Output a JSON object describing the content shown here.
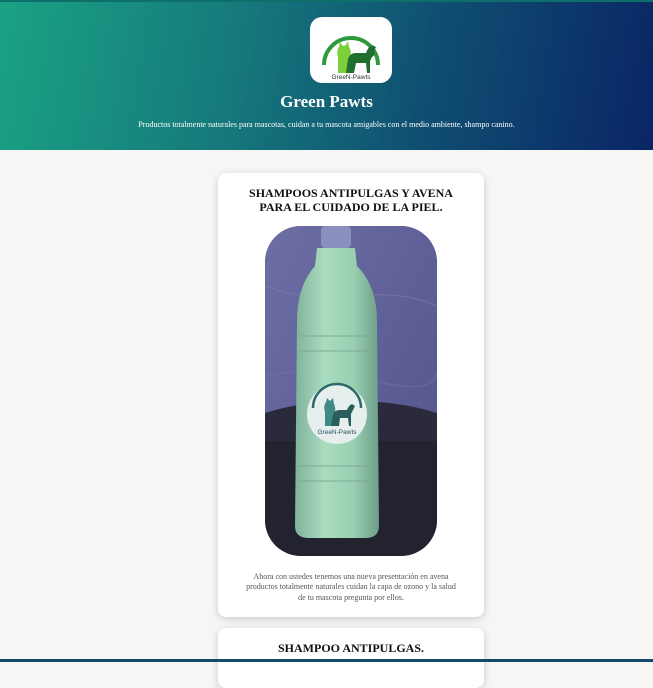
{
  "header": {
    "title": "Green Pawts",
    "tagline": "Productos totalmente naturales para mascotas, cuidan a tu mascota amigables con el medio ambiente, shampo canino.",
    "logo_text": "GreeN-Pawts",
    "logo_icon": "cat-dog-logo-icon",
    "gradient_start": "#1aa284",
    "gradient_end": "#0a2565"
  },
  "products": [
    {
      "title": "SHAMPOOS ANTIPULGAS Y AVENA PARA EL CUIDADO DE LA PIEL.",
      "label_text": "GreeN-Pawts",
      "description": "Ahora con ustedes tenemos una nueva presentación en avena productos totalmente naturales cuidan la capa de ozono y la salud de tu mascota pregunta por ellos."
    },
    {
      "title": "SHAMPOO ANTIPULGAS."
    }
  ]
}
